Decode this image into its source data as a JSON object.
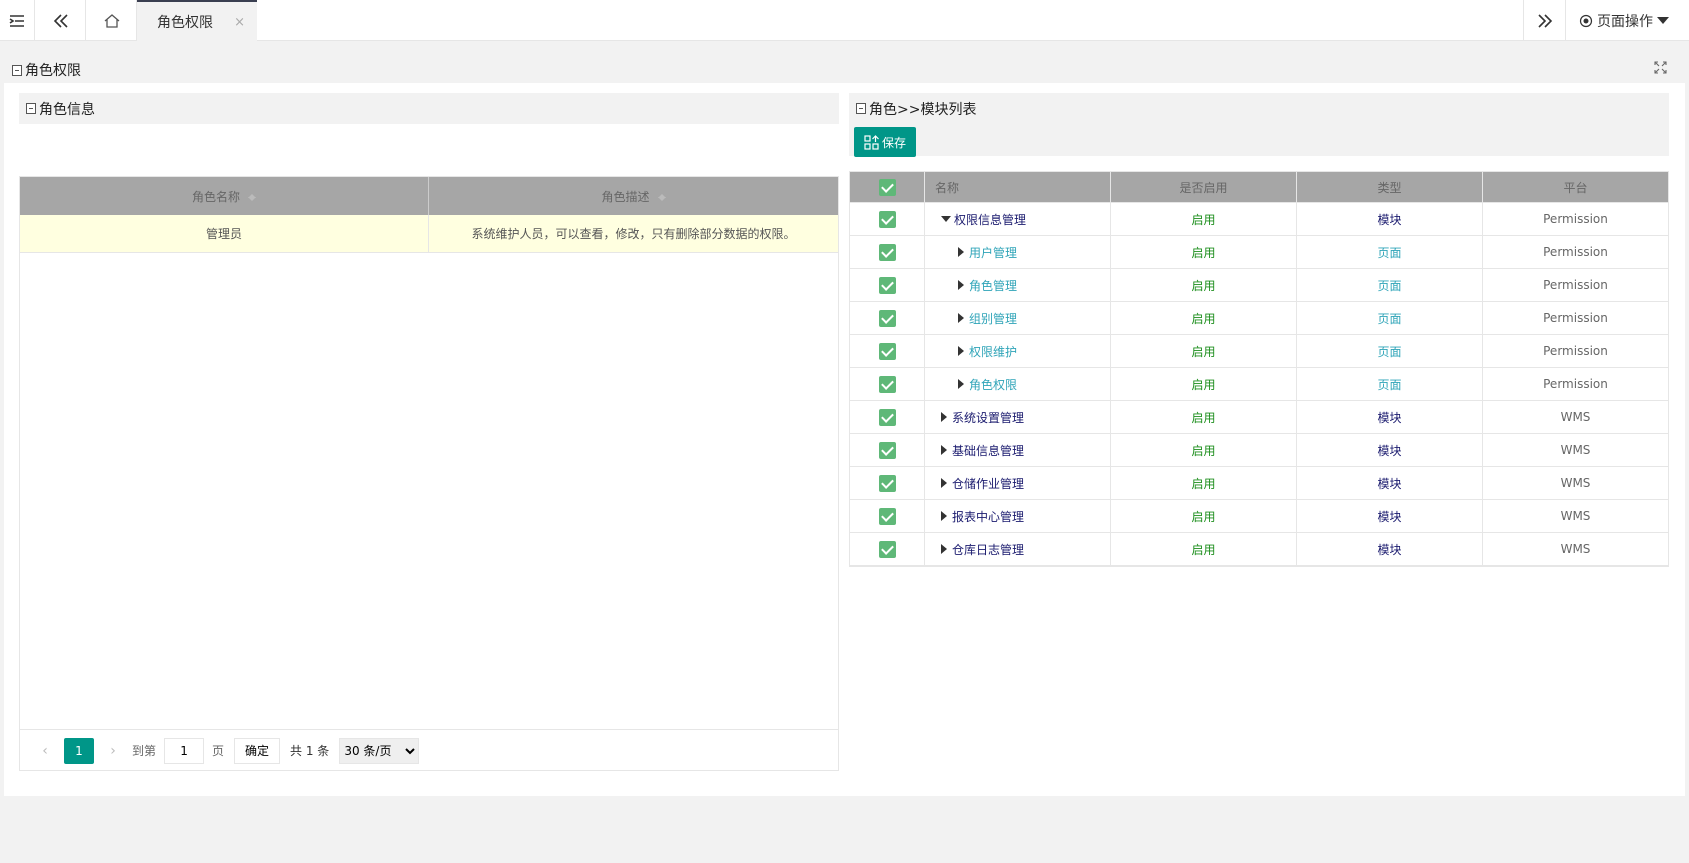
{
  "topbar": {
    "active_tab": "角色权限",
    "tab_close": "×",
    "page_ops_label": "页面操作"
  },
  "panel": {
    "title": "角色权限"
  },
  "role_info": {
    "title": "角色信息",
    "columns": [
      "角色名称",
      "角色描述"
    ],
    "rows": [
      {
        "name": "管理员",
        "desc": "系统维护人员，可以查看，修改，只有删除部分数据的权限。"
      }
    ],
    "pager": {
      "current": "1",
      "goto_label": "到第",
      "page_value": "1",
      "page_unit": "页",
      "confirm": "确定",
      "total": "共 1 条",
      "per_page": "30 条/页"
    }
  },
  "module_list": {
    "title": "角色>>模块列表",
    "save_label": "保存",
    "columns": [
      "名称",
      "是否启用",
      "类型",
      "平台"
    ],
    "rows": [
      {
        "name": "权限信息管理",
        "enabled": "启用",
        "type": "模块",
        "platform": "Permission"
      },
      {
        "name": "用户管理",
        "enabled": "启用",
        "type": "页面",
        "platform": "Permission"
      },
      {
        "name": "角色管理",
        "enabled": "启用",
        "type": "页面",
        "platform": "Permission"
      },
      {
        "name": "组别管理",
        "enabled": "启用",
        "type": "页面",
        "platform": "Permission"
      },
      {
        "name": "权限维护",
        "enabled": "启用",
        "type": "页面",
        "platform": "Permission"
      },
      {
        "name": "角色权限",
        "enabled": "启用",
        "type": "页面",
        "platform": "Permission"
      },
      {
        "name": "系统设置管理",
        "enabled": "启用",
        "type": "模块",
        "platform": "WMS"
      },
      {
        "name": "基础信息管理",
        "enabled": "启用",
        "type": "模块",
        "platform": "WMS"
      },
      {
        "name": "仓储作业管理",
        "enabled": "启用",
        "type": "模块",
        "platform": "WMS"
      },
      {
        "name": "报表中心管理",
        "enabled": "启用",
        "type": "模块",
        "platform": "WMS"
      },
      {
        "name": "仓库日志管理",
        "enabled": "启用",
        "type": "模块",
        "platform": "WMS"
      }
    ]
  },
  "colors": {
    "accent": "#009688",
    "checkbox": "#5fb878",
    "selected_row": "#ffffe0"
  }
}
